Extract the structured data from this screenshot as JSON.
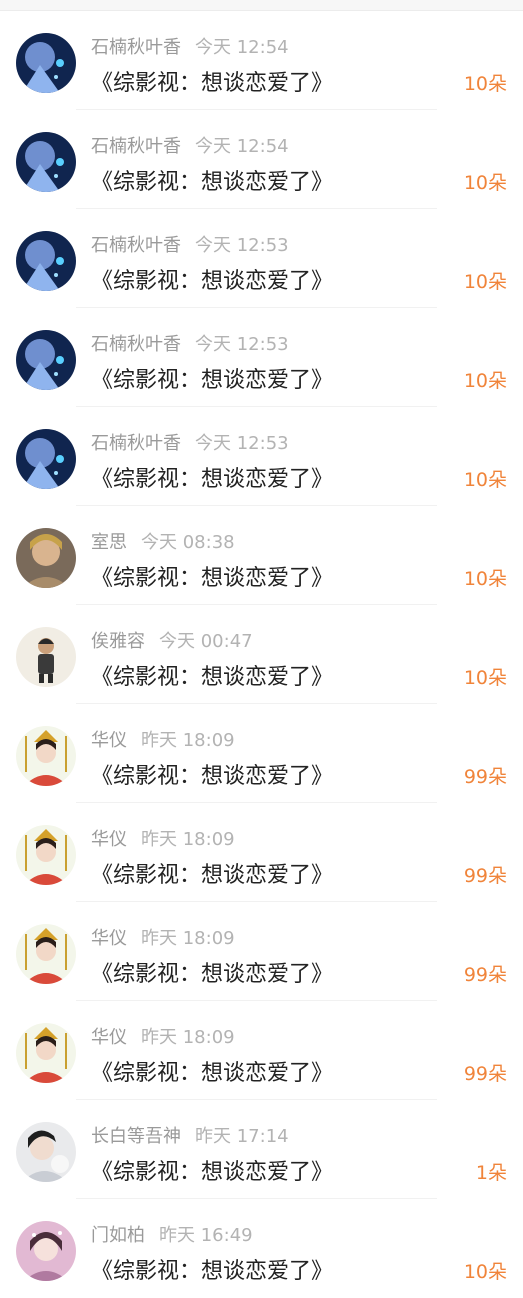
{
  "items": [
    {
      "name": "石楠秋叶香",
      "time": "今天 12:54",
      "title": "《综影视：想谈恋爱了》",
      "gift": "10朵",
      "avatar": "fantasy-girl-avatar"
    },
    {
      "name": "石楠秋叶香",
      "time": "今天 12:54",
      "title": "《综影视：想谈恋爱了》",
      "gift": "10朵",
      "avatar": "fantasy-girl-avatar"
    },
    {
      "name": "石楠秋叶香",
      "time": "今天 12:53",
      "title": "《综影视：想谈恋爱了》",
      "gift": "10朵",
      "avatar": "fantasy-girl-avatar"
    },
    {
      "name": "石楠秋叶香",
      "time": "今天 12:53",
      "title": "《综影视：想谈恋爱了》",
      "gift": "10朵",
      "avatar": "fantasy-girl-avatar"
    },
    {
      "name": "石楠秋叶香",
      "time": "今天 12:53",
      "title": "《综影视：想谈恋爱了》",
      "gift": "10朵",
      "avatar": "fantasy-girl-avatar"
    },
    {
      "name": "室思",
      "time": "今天 08:38",
      "title": "《综影视：想谈恋爱了》",
      "gift": "10朵",
      "avatar": "painted-girl-avatar"
    },
    {
      "name": "俟雅容",
      "time": "今天 00:47",
      "title": "《综影视：想谈恋爱了》",
      "gift": "10朵",
      "avatar": "cartoon-soldier-avatar"
    },
    {
      "name": "华仪",
      "time": "昨天 18:09",
      "title": "《综影视：想谈恋爱了》",
      "gift": "99朵",
      "avatar": "ancient-lady-avatar"
    },
    {
      "name": "华仪",
      "time": "昨天 18:09",
      "title": "《综影视：想谈恋爱了》",
      "gift": "99朵",
      "avatar": "ancient-lady-avatar"
    },
    {
      "name": "华仪",
      "time": "昨天 18:09",
      "title": "《综影视：想谈恋爱了》",
      "gift": "99朵",
      "avatar": "ancient-lady-avatar"
    },
    {
      "name": "华仪",
      "time": "昨天 18:09",
      "title": "《综影视：想谈恋爱了》",
      "gift": "99朵",
      "avatar": "ancient-lady-avatar"
    },
    {
      "name": "长白等吾神",
      "time": "昨天 17:14",
      "title": "《综影视：想谈恋爱了》",
      "gift": "1朵",
      "avatar": "photo-girl-avatar"
    },
    {
      "name": "门如柏",
      "time": "昨天 16:49",
      "title": "《综影视：想谈恋爱了》",
      "gift": "10朵",
      "avatar": "pink-girl-avatar"
    }
  ],
  "colors": {
    "gift": "#f0843a",
    "name": "#9a9a9a",
    "title": "#222222"
  }
}
